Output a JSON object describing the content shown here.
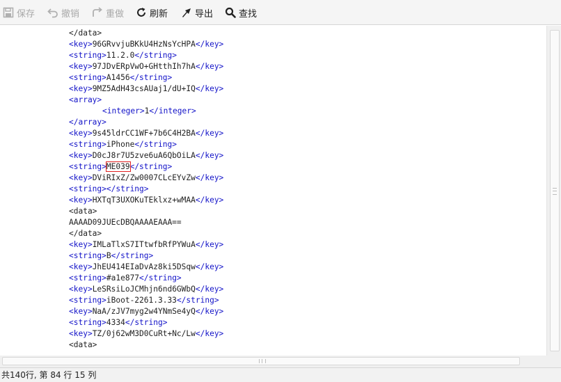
{
  "toolbar": {
    "save": {
      "label": "保存",
      "icon": "save-icon",
      "enabled": false
    },
    "undo": {
      "label": "撤销",
      "icon": "undo-icon",
      "enabled": false
    },
    "redo": {
      "label": "重做",
      "icon": "redo-icon",
      "enabled": false
    },
    "refresh": {
      "label": "刷新",
      "icon": "refresh-icon",
      "enabled": true
    },
    "export": {
      "label": "导出",
      "icon": "export-icon",
      "enabled": true
    },
    "find": {
      "label": "查找",
      "icon": "search-icon",
      "enabled": true
    }
  },
  "editor": {
    "lines": [
      {
        "type": "close",
        "tag": "data"
      },
      {
        "type": "elem",
        "tag": "key",
        "text": "96GRvvjuBKkU4HzNsYcHPA"
      },
      {
        "type": "elem",
        "tag": "string",
        "text": "11.2.0"
      },
      {
        "type": "elem",
        "tag": "key",
        "text": "97JDvERpVwO+GHtthIh7hA"
      },
      {
        "type": "elem",
        "tag": "string",
        "text": "A1456"
      },
      {
        "type": "elem",
        "tag": "key",
        "text": "9MZ5AdH43csAUaj1/dU+IQ"
      },
      {
        "type": "open",
        "tag": "array"
      },
      {
        "type": "elem",
        "tag": "integer",
        "text": "1",
        "indent": true
      },
      {
        "type": "close",
        "tag": "array"
      },
      {
        "type": "elem",
        "tag": "key",
        "text": "9s45ldrCC1WF+7b6C4H2BA"
      },
      {
        "type": "elem",
        "tag": "string",
        "text": "iPhone"
      },
      {
        "type": "elem",
        "tag": "key",
        "text": "D0cJ8r7U5zve6uA6QbOiLA"
      },
      {
        "type": "elem",
        "tag": "string",
        "text": "ME039",
        "highlight": true
      },
      {
        "type": "elem",
        "tag": "key",
        "text": "DViRIxZ/Zw0007CLcEYvZw"
      },
      {
        "type": "elem",
        "tag": "string",
        "text": ""
      },
      {
        "type": "elem",
        "tag": "key",
        "text": "HXTqT3UXOKuTEklxz+wMAA"
      },
      {
        "type": "open",
        "tag": "data"
      },
      {
        "type": "text",
        "text": "AAAAD09JUEcDBQAAAAEAAA=="
      },
      {
        "type": "close",
        "tag": "data"
      },
      {
        "type": "elem",
        "tag": "key",
        "text": "IMLaTlxS7ITtwfbRfPYWuA"
      },
      {
        "type": "elem",
        "tag": "string",
        "text": "B"
      },
      {
        "type": "elem",
        "tag": "key",
        "text": "JhEU414EIaDvAz8ki5DSqw"
      },
      {
        "type": "elem",
        "tag": "string",
        "text": "#a1e877"
      },
      {
        "type": "elem",
        "tag": "key",
        "text": "LeSRsiLoJCMhjn6nd6GWbQ"
      },
      {
        "type": "elem",
        "tag": "string",
        "text": "iBoot-2261.3.33"
      },
      {
        "type": "elem",
        "tag": "key",
        "text": "NaA/zJV7myg2w4YNmSe4yQ"
      },
      {
        "type": "elem",
        "tag": "string",
        "text": "4334"
      },
      {
        "type": "elem",
        "tag": "key",
        "text": "TZ/0j62wM3D0CuRt+Nc/Lw"
      },
      {
        "type": "open",
        "tag": "data"
      }
    ]
  },
  "status": {
    "text": "共140行,  第 84 行 15 列"
  },
  "colors": {
    "tag": "#1212c8",
    "text": "#222222",
    "highlight_border": "#e02020",
    "toolbar_bg": "#f5f5f5"
  }
}
